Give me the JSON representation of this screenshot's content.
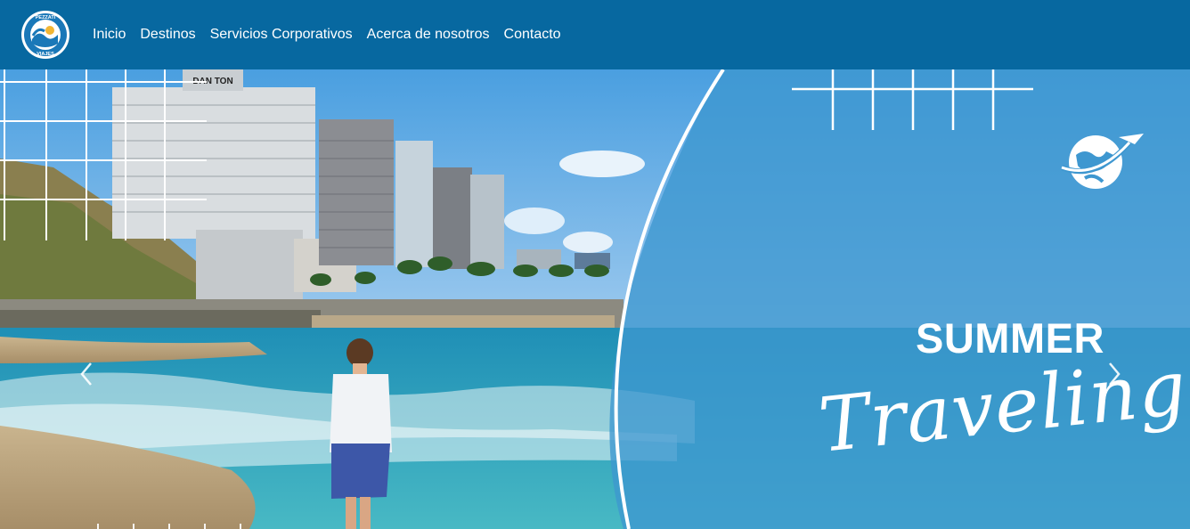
{
  "brand": {
    "logo_lines": [
      "PEZZATI",
      "VIAJES"
    ]
  },
  "nav": {
    "items": [
      "Inicio",
      "Destinos",
      "Servicios Corporativos",
      "Acerca de nosotros",
      "Contacto"
    ]
  },
  "hero": {
    "headline": "SUMMER",
    "script_text": "Traveling",
    "hotel_sign": "DAN TON"
  },
  "colors": {
    "navbar": "#0768a0",
    "overlay": "#3e97d0",
    "sea": "#33a8bf"
  },
  "icons": {
    "globe_plane": "globe-plane-icon",
    "prev": "chevron-left-icon",
    "next": "chevron-right-icon"
  }
}
